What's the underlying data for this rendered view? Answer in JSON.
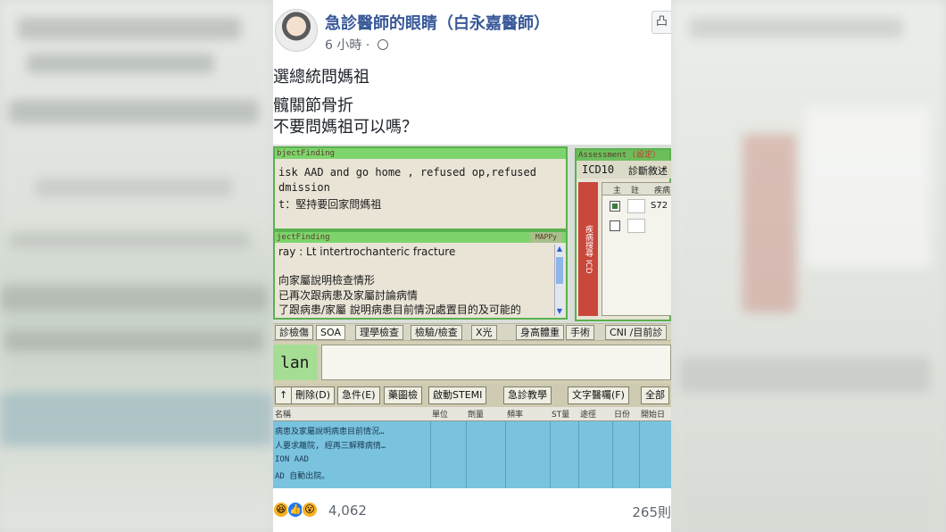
{
  "post": {
    "author": "急診醫師的眼睛（白永嘉醫師）",
    "time": "6 小時",
    "separator": "·",
    "like_label": "凸",
    "lines": [
      "選總統問媽祖",
      "髖關節骨折",
      "不要問媽祖可以嗎？"
    ]
  },
  "photo": {
    "subjective_header": "bjectFinding",
    "subjective_lines": [
      "isk AAD and go home , refused op,refused",
      "dmission",
      "t：堅持要回家問媽祖"
    ],
    "objective_header": "jectFinding",
    "objective_badge": "MAPPy",
    "objective_lines": [
      "ray : Lt intertrochanteric fracture",
      "",
      "向家屬說明檢查情形",
      "已再次跟病患及家屬討論病情",
      "了跟病患/家屬 說明病患目前情況處置目的及可能的"
    ],
    "assessment_title": "Assessment",
    "assessment_badge": "(設定）",
    "icd_label": "ICD10",
    "dx_label": "診斷敘述",
    "col_main": "主",
    "col_note": "註",
    "col_code": "疾病",
    "row1_code": "S72",
    "side_label": "疾病搜尋 ICD",
    "tabs": [
      "診檢傷",
      "SOA",
      "理學檢查",
      "檢驗/檢查",
      "X光",
      "身高體重",
      "手術",
      "CNI /目前診"
    ],
    "plan_label": "lan",
    "buttons": [
      "↑",
      "刪除(D)",
      "急件(E)",
      "藥圖檢",
      "啟動STEMI",
      "急診教學",
      "文字醫囑(F)",
      "全部"
    ],
    "grid_headers": [
      "名稱",
      "單位",
      "劑量",
      "頻率",
      "ST量",
      "途徑",
      "日份",
      "開始日"
    ],
    "grid_lines": [
      "病患及家屬說明病患目前情況…",
      "人要求離院, 經再三解釋病情…",
      "ION AAD",
      "AD 自動出院。"
    ]
  },
  "reactions": {
    "icons": [
      "haha",
      "like",
      "wow"
    ],
    "count": "4,062",
    "comments": "265則"
  },
  "colors": {
    "author": "#385898",
    "header_green": "#7dd46c",
    "grid_blue": "#79c3df"
  }
}
